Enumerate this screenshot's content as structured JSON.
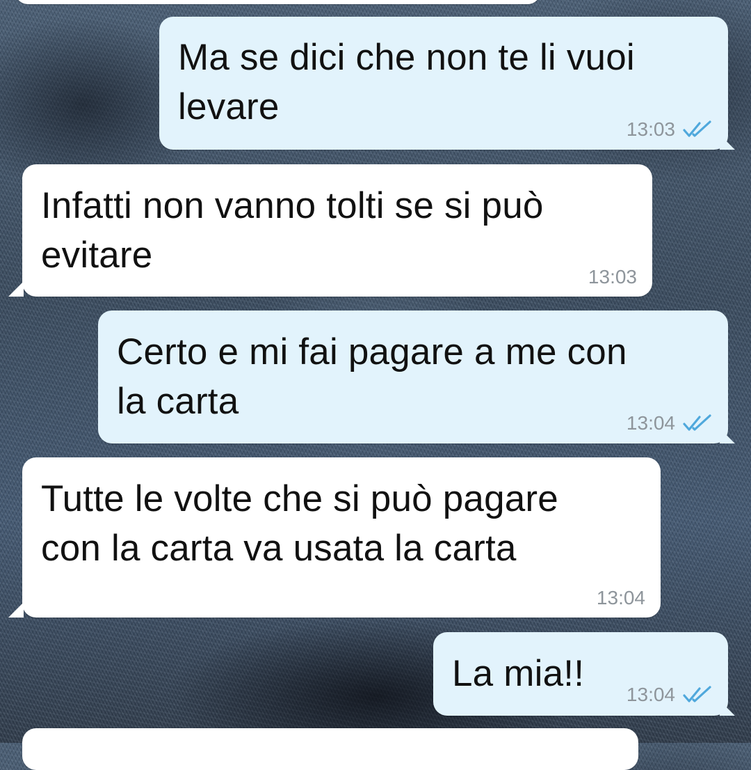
{
  "messages": [
    {
      "id": "m0",
      "direction": "incoming",
      "text": "",
      "time": ""
    },
    {
      "id": "m1",
      "direction": "outgoing",
      "text": "Ma se dici che non te li vuoi\nlevare",
      "time": "13:03",
      "read_ticks": "double-check-icon"
    },
    {
      "id": "m2",
      "direction": "incoming",
      "text": "Infatti non vanno tolti se si può\nevitare",
      "time": "13:03"
    },
    {
      "id": "m3",
      "direction": "outgoing",
      "text": "Certo e mi fai pagare a me con\nla carta",
      "time": "13:04",
      "read_ticks": "double-check-icon"
    },
    {
      "id": "m4",
      "direction": "incoming",
      "text": "Tutte le volte che si può pagare\ncon la carta va usata la carta",
      "time": "13:04"
    },
    {
      "id": "m5",
      "direction": "outgoing",
      "text": "La mia!!",
      "time": "13:04",
      "read_ticks": "double-check-icon"
    },
    {
      "id": "m6",
      "direction": "incoming",
      "text": "",
      "time": ""
    }
  ],
  "colors": {
    "incoming_bubble": "#ffffff",
    "outgoing_bubble": "#e2f3fc",
    "read_ticks": "#4fa8dc",
    "timestamp": "#8e959b"
  }
}
